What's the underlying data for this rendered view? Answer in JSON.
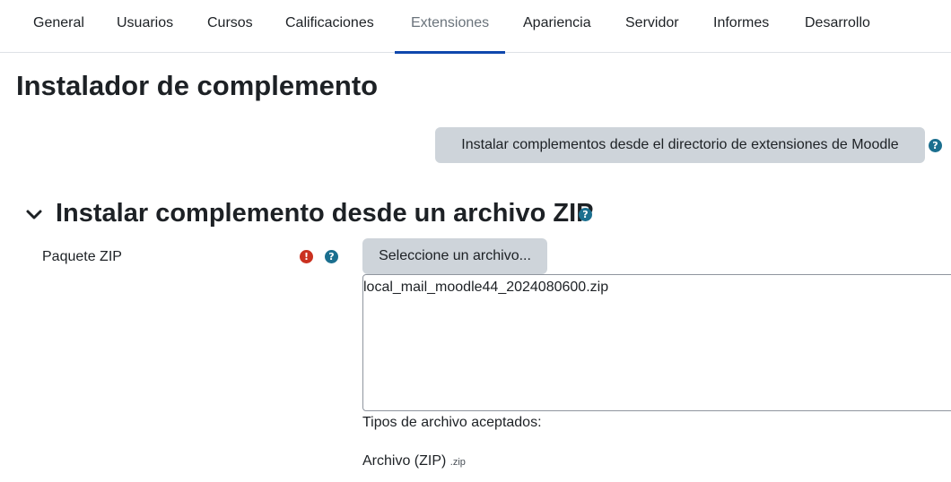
{
  "nav": {
    "tabs": [
      {
        "label": "General"
      },
      {
        "label": "Usuarios"
      },
      {
        "label": "Cursos"
      },
      {
        "label": "Calificaciones"
      },
      {
        "label": "Extensiones",
        "active": true
      },
      {
        "label": "Apariencia"
      },
      {
        "label": "Servidor"
      },
      {
        "label": "Informes"
      },
      {
        "label": "Desarrollo"
      }
    ]
  },
  "page": {
    "title": "Instalador de complemento",
    "directory_button": "Instalar complementos desde el directorio de extensiones de Moodle"
  },
  "section": {
    "title": "Instalar complemento desde un archivo ZIP",
    "expanded": true
  },
  "form": {
    "zip_label": "Paquete ZIP",
    "select_button": "Seleccione un archivo...",
    "filename": "local_mail_moodle44_2024080600.zip",
    "accepted_label": "Tipos de archivo aceptados:",
    "accepted_type": "Archivo (ZIP)",
    "accepted_ext": ".zip"
  },
  "icons": {
    "help": "question-circle-icon",
    "required": "exclamation-circle-icon",
    "expand": "chevron-down-icon"
  },
  "colors": {
    "accent": "#0f47ad",
    "help": "#1b6f8f",
    "required": "#ca3120",
    "button_bg": "#ced4da"
  }
}
